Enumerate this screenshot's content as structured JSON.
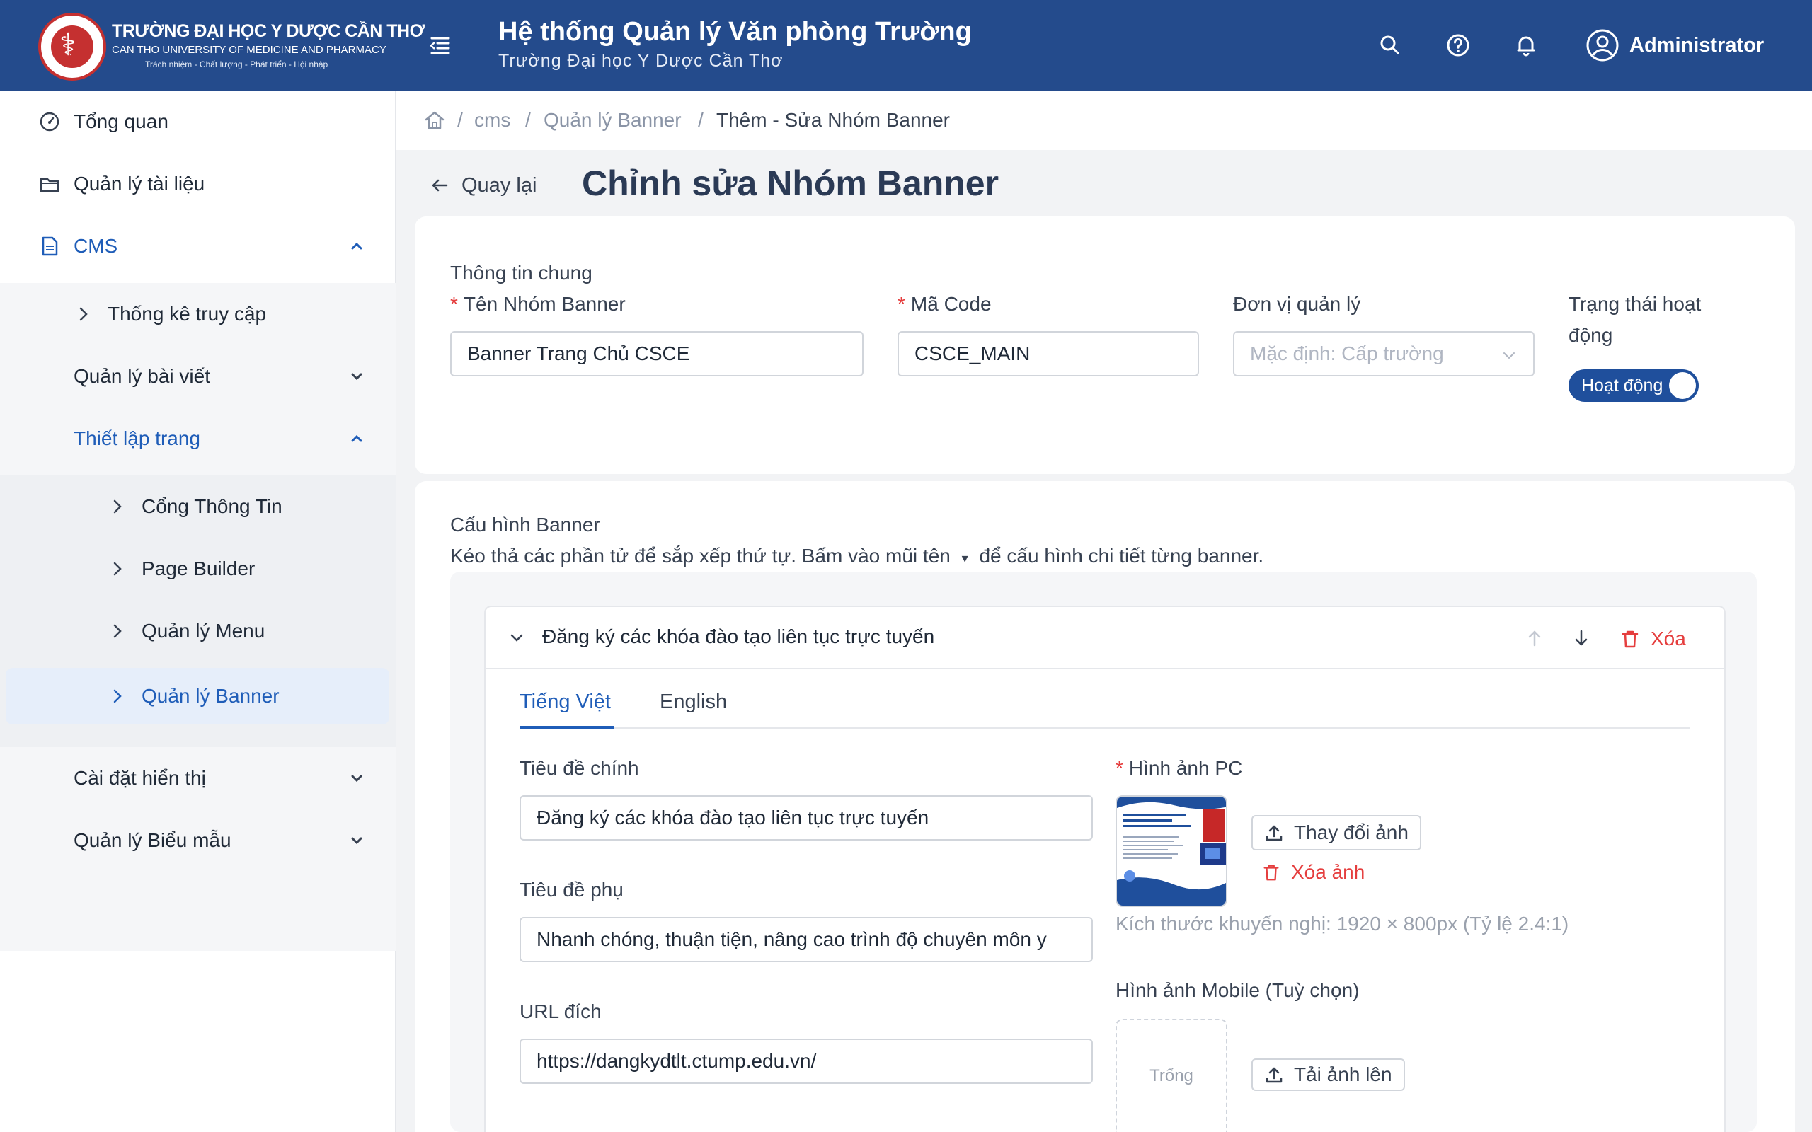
{
  "header": {
    "univ_name_vn": "TRƯỜNG ĐẠI HỌC Y DƯỢC CẦN THƠ",
    "univ_name_en": "CAN THO UNIVERSITY OF MEDICINE AND PHARMACY",
    "univ_motto": "Trách nhiệm - Chất lượng - Phát triển - Hội nhập",
    "title": "Hệ thống Quản lý Văn phòng Trường",
    "subtitle": "Trường Đại học Y Dược Cần Thơ",
    "user_name": "Administrator"
  },
  "sidebar": {
    "items": [
      {
        "label": "Tổng quan",
        "icon": "dashboard-icon"
      },
      {
        "label": "Quản lý tài liệu",
        "icon": "folder-icon"
      },
      {
        "label": "CMS",
        "icon": "document-icon"
      }
    ],
    "cms_children": [
      {
        "label": "Thống kê truy cập"
      },
      {
        "label": "Quản lý bài viết"
      },
      {
        "label": "Thiết lập trang"
      }
    ],
    "page_setup_children": [
      {
        "label": "Cổng Thông Tin"
      },
      {
        "label": "Page Builder"
      },
      {
        "label": "Quản lý Menu"
      },
      {
        "label": "Quản lý Banner"
      }
    ],
    "more": [
      {
        "label": "Cài đặt hiển thị"
      },
      {
        "label": "Quản lý Biểu mẫu"
      }
    ]
  },
  "breadcrumb": {
    "items": [
      "cms",
      "Quản lý Banner",
      "Thêm - Sửa Nhóm Banner"
    ],
    "separator": "/"
  },
  "page": {
    "back_label": "Quay lại",
    "title": "Chỉnh sửa Nhóm Banner"
  },
  "general": {
    "section_title": "Thông tin chung",
    "required_mark": "*",
    "name_label": "Tên Nhóm Banner",
    "name_value": "Banner Trang Chủ CSCE",
    "code_label": "Mã Code",
    "code_value": "CSCE_MAIN",
    "unit_label": "Đơn vị quản lý",
    "unit_placeholder": "Mặc định: Cấp trường",
    "status_label_line1": "Trạng thái hoạt",
    "status_label_line2": "động",
    "status_value": "Hoạt động"
  },
  "banner_config": {
    "section_title": "Cấu hình Banner",
    "hint_before": "Kéo thả các phần tử để sắp xếp thứ tự. Bấm vào mũi tên",
    "hint_arrow": "▾",
    "hint_after": "để cấu hình chi tiết từng banner.",
    "item": {
      "title": "Đăng ký các khóa đào tạo liên tục trực tuyến",
      "delete_label": "Xóa",
      "tabs": [
        "Tiếng Việt",
        "English"
      ],
      "main_title_label": "Tiêu đề chính",
      "main_title_value": "Đăng ký các khóa đào tạo liên tục trực tuyến",
      "sub_title_label": "Tiêu đề phụ",
      "sub_title_value": "Nhanh chóng, thuận tiện, nâng cao trình độ chuyên môn y",
      "url_label": "URL đích",
      "url_value": "https://dangkydtlt.ctump.edu.vn/",
      "pc_image_label": "Hình ảnh PC",
      "change_image_label": "Thay đổi ảnh",
      "delete_image_label": "Xóa ảnh",
      "size_hint": "Kích thước khuyến nghị: 1920 × 800px (Tỷ lệ 2.4:1)",
      "mobile_image_label": "Hình ảnh Mobile (Tuỳ chọn)",
      "empty_label": "Trống",
      "upload_label": "Tải ảnh lên"
    }
  },
  "colors": {
    "header_bg": "#244b8c",
    "accent": "#1f5db8",
    "danger": "#e53e3e"
  }
}
